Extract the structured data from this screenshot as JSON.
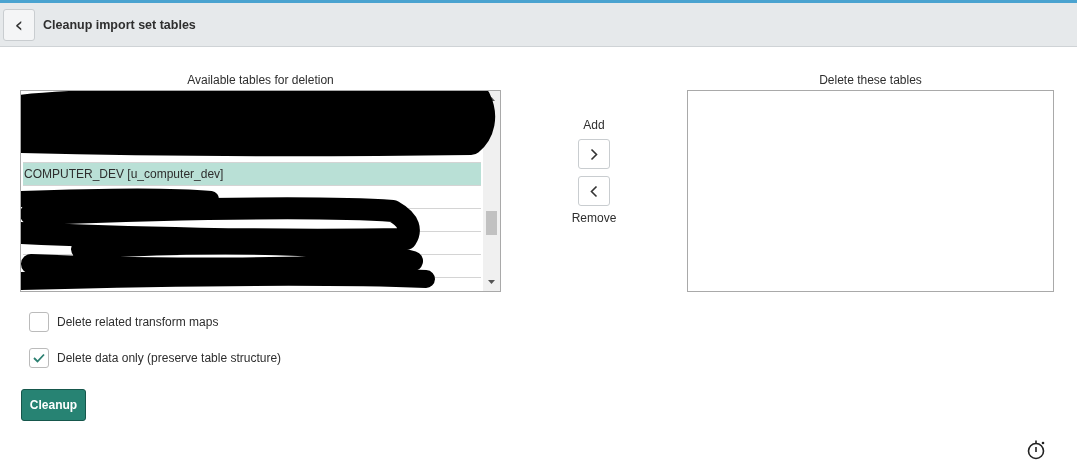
{
  "header": {
    "back_icon": "‹",
    "title": "Cleanup import set tables"
  },
  "available": {
    "label": "Available tables for deletion",
    "items": [
      {
        "label": "COMPUTER_DEV [u_computer_dev]",
        "selected": true
      }
    ]
  },
  "mover": {
    "add_label": "Add",
    "remove_label": "Remove"
  },
  "selected_list": {
    "label": "Delete these tables"
  },
  "options": [
    {
      "label": "Delete related transform maps",
      "checked": false
    },
    {
      "label": "Delete data only (preserve table structure)",
      "checked": true
    }
  ],
  "action": {
    "label": "Cleanup"
  }
}
